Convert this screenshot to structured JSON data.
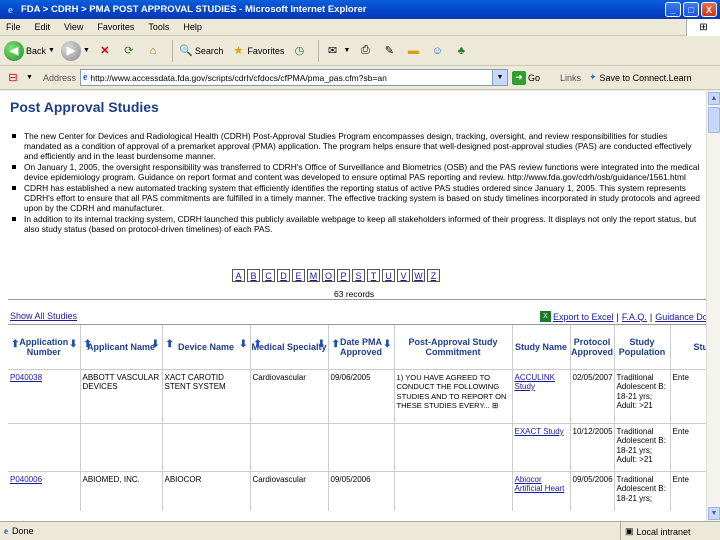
{
  "window": {
    "title": "FDA > CDRH > PMA POST APPROVAL STUDIES - Microsoft Internet Explorer",
    "min": "_",
    "max": "□",
    "close": "X"
  },
  "menu": [
    "File",
    "Edit",
    "View",
    "Favorites",
    "Tools",
    "Help"
  ],
  "toolbar": {
    "back": "Back",
    "search": "Search",
    "favorites": "Favorites"
  },
  "address": {
    "label": "Address",
    "url": "http://www.accessdata.fda.gov/scripts/cdrh/cfdocs/cfPMA/pma_pas.cfm?sb=an",
    "go": "Go",
    "links": "Links",
    "save": "Save to Connect.Learn"
  },
  "page": {
    "title": "Post Approval Studies",
    "bullets": [
      "The new Center for Devices and Radiological Health (CDRH) Post-Approval Studies Program encompasses design, tracking, oversight, and review responsibilities for studies mandated as a condition of approval of a premarket approval (PMA) application. The program helps ensure that well-designed post-approval studies (PAS) are conducted effectively and efficiently and in the least burdensome manner.",
      "On January 1, 2005, the oversight responsibility was transferred to CDRH's Office of Surveillance and Biometrics (OSB) and the PAS review functions were integrated into the medical device epidemiology program. Guidance on report format and content was developed to ensure optimal PAS reporting and review. http://www.fda.gov/cdrh/osb/guidance/1561.html",
      "CDRH has established a new automated tracking system that efficiently identifies the reporting status of active PAS studies ordered since January 1, 2005. This system represents CDRH's effort to ensure that all PAS commitments are fulfilled in a timely manner. The effective tracking system is based on study timelines incorporated in study protocols and agreed upon by the CDRH and manufacturer.",
      "In addition to its internal tracking system, CDRH launched this publicly available webpage to keep all stakeholders informed of their progress. It displays not only the report status, but also study status (based on protocol-driven timelines) of each PAS."
    ],
    "letters": [
      "A",
      "B",
      "C",
      "D",
      "E",
      "M",
      "O",
      "P",
      "S",
      "T",
      "U",
      "V",
      "W",
      "Z"
    ],
    "records": "63 records",
    "show_all": "Show All Studies",
    "export": "Export to Excel",
    "faq": "F.A.Q.",
    "guidance": "Guidance Docu"
  },
  "table": {
    "headers": [
      "Application Number",
      "Applicant Name",
      "Device Name",
      "Medical Specialty",
      "Date PMA Approved",
      "Post-Approval Study Commitment",
      "Study Name",
      "Protocol Approved",
      "Study Population",
      "Stu Sta"
    ],
    "rows": [
      {
        "app": "P040038",
        "applicant": "ABBOTT VASCULAR DEVICES",
        "device": "XACT CAROTID STENT SYSTEM",
        "specialty": "Cardiovascular",
        "date": "09/06/2005",
        "commitment": "1) YOU HAVE AGREED TO CONDUCT THE FOLLOWING STUDIES AND TO REPORT ON THESE STUDIES EVERY...",
        "study": "ACCULINK Study",
        "protocol": "02/05/2007",
        "population": "Traditional Adolescent B: 18-21 yrs; Adult: >21",
        "status": "Ente"
      },
      {
        "app": "",
        "applicant": "",
        "device": "",
        "specialty": "",
        "date": "",
        "commitment": "",
        "study": "EXACT Study",
        "protocol": "10/12/2005",
        "population": "Traditional Adolescent B: 18-21 yrs; Adult: >21",
        "status": "Ente"
      },
      {
        "app": "P040006",
        "applicant": "ABIOMED, INC.",
        "device": "ABIOCOR",
        "specialty": "Cardiovascular",
        "date": "09/05/2006",
        "commitment": "",
        "study": "Abiocor Artificial Heart",
        "protocol": "09/05/2006",
        "population": "Traditional Adolescent B: 18-21 yrs;",
        "status": "Ente"
      }
    ]
  },
  "status": {
    "text": "Done",
    "zone": "Local intranet"
  }
}
